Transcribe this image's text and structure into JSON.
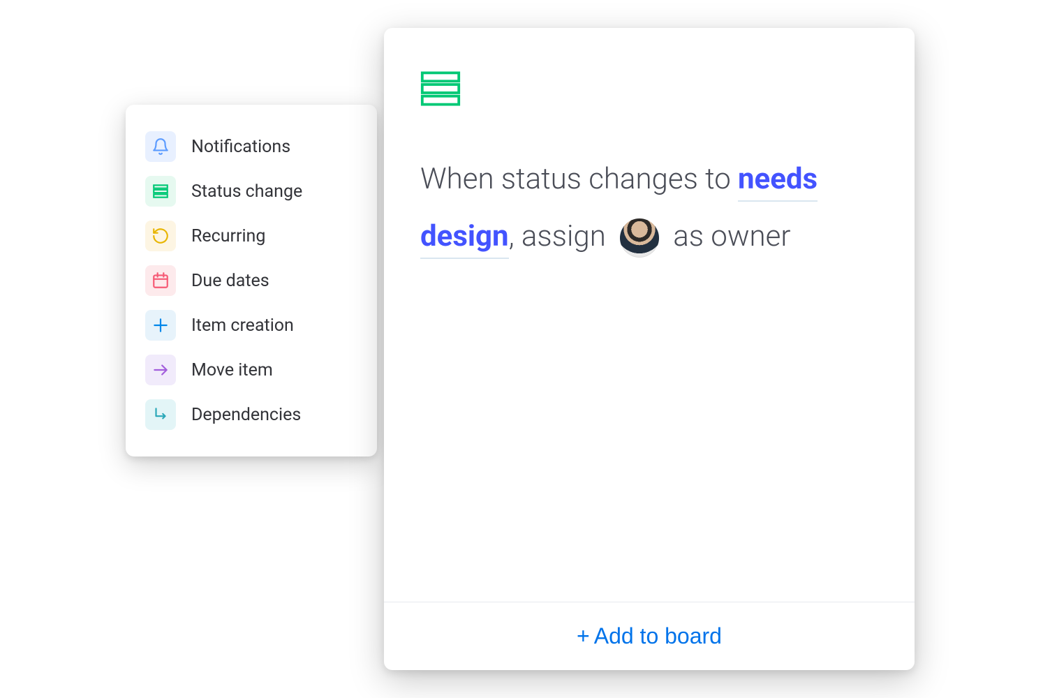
{
  "menu": {
    "items": [
      {
        "label": "Notifications",
        "icon": "bell-icon",
        "color": "#3b82f6",
        "bg": "bg-blue-soft"
      },
      {
        "label": "Status change",
        "icon": "rows-icon",
        "color": "#00c875",
        "bg": "bg-green-soft"
      },
      {
        "label": "Recurring",
        "icon": "refresh-icon",
        "color": "#e8b500",
        "bg": "bg-yellow-soft"
      },
      {
        "label": "Due dates",
        "icon": "calendar-icon",
        "color": "#f65a75",
        "bg": "bg-red-soft"
      },
      {
        "label": "Item creation",
        "icon": "plus-icon",
        "color": "#0086ea",
        "bg": "bg-lightblue-soft"
      },
      {
        "label": "Move item",
        "icon": "arrow-right-icon",
        "color": "#a25ddc",
        "bg": "bg-purple-soft"
      },
      {
        "label": "Dependencies",
        "icon": "dependency-icon",
        "color": "#2aa7b8",
        "bg": "bg-teal-soft"
      }
    ]
  },
  "recipe": {
    "text_part1": "When status changes to ",
    "highlight": "needs design",
    "text_part2": ", assign ",
    "text_part3": " as owner",
    "add_button": "Add to board",
    "plus_symbol": "+"
  },
  "colors": {
    "accent_green": "#00c875",
    "link_blue": "#0073ea",
    "highlight_blue": "#4353ff"
  }
}
